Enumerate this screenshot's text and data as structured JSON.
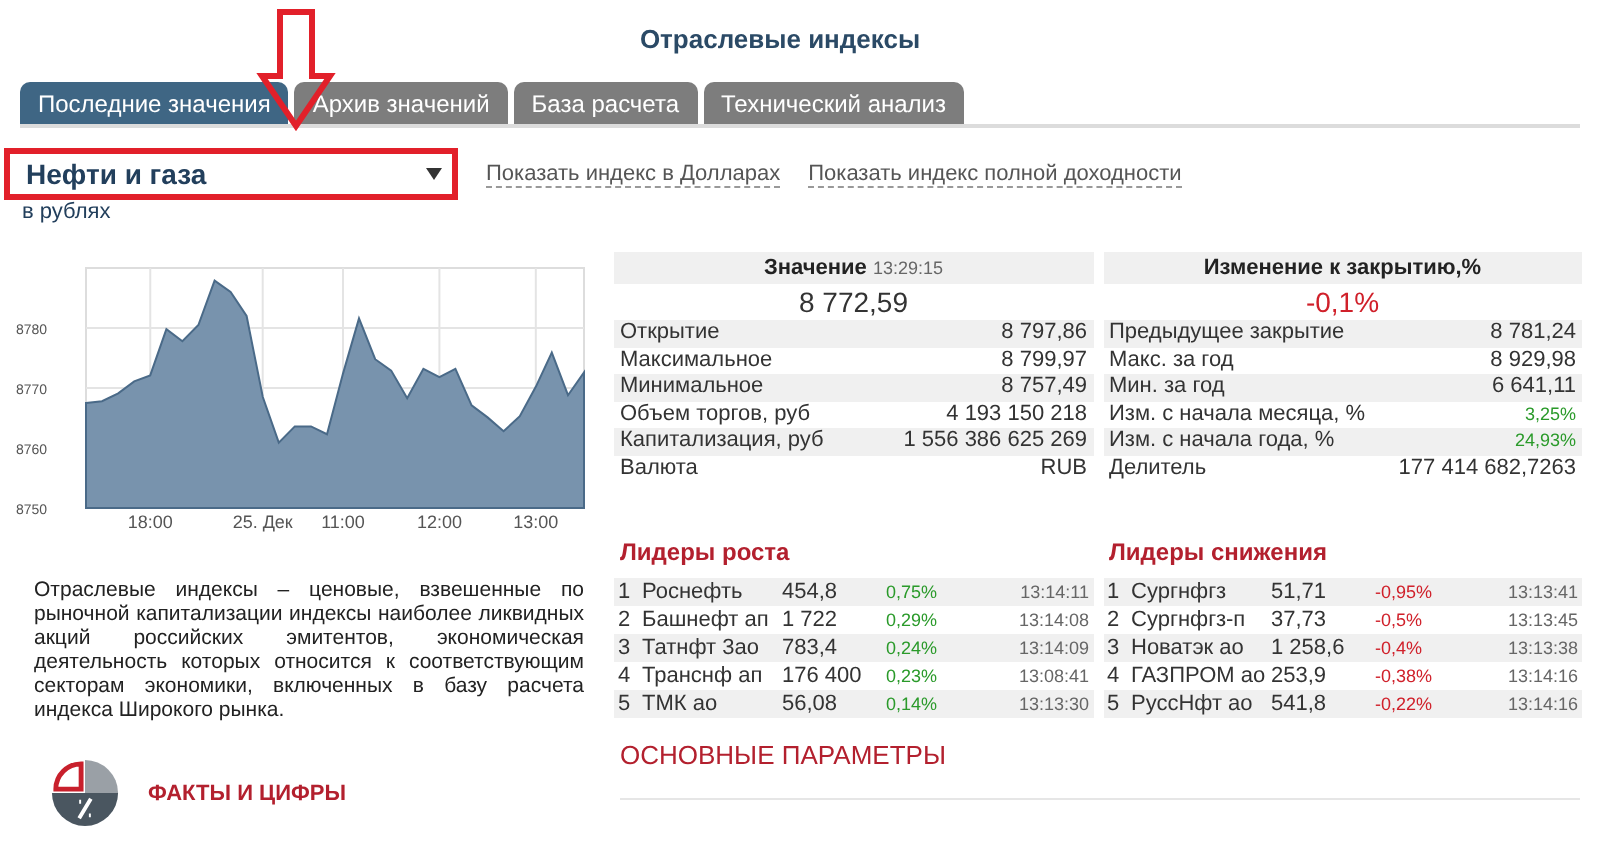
{
  "page_title": "Отраслевые индексы",
  "tabs": [
    {
      "label": "Последние значения",
      "selected": true
    },
    {
      "label": "Архив значений",
      "selected": false
    },
    {
      "label": "База расчета",
      "selected": false
    },
    {
      "label": "Технический анализ",
      "selected": false
    }
  ],
  "index_select": {
    "value": "Нефти и газа"
  },
  "links": [
    "Показать индекс в Долларах",
    "Показать индекс полной доходности"
  ],
  "currency_note": "в рублях",
  "chart": {
    "chart_data": {
      "type": "area",
      "categories": [
        null,
        null,
        null,
        null,
        "18:00",
        null,
        null,
        null,
        null,
        null,
        null,
        "25. Дек",
        null,
        null,
        null,
        null,
        "11:00",
        null,
        null,
        null,
        null,
        null,
        "12:00",
        null,
        null,
        null,
        null,
        null,
        "13:00",
        null,
        null,
        null
      ],
      "series": [
        {
          "color": "#7893ad",
          "values": [
            8767.5,
            8767.8,
            8769.1,
            8771.1,
            8772.1,
            8779.8,
            8777.8,
            8780.5,
            8787.9,
            8786,
            8782,
            8768.5,
            8760.9,
            8763.6,
            8763.6,
            8762.3,
            8772.4,
            8781.6,
            8774.8,
            8772.9,
            8768.3,
            8773.2,
            8771.8,
            8773.2,
            8767.1,
            8765.1,
            8762.8,
            8765.3,
            8770.2,
            8775.9,
            8768.8,
            8772.6
          ]
        }
      ],
      "ylim": [
        8750,
        8790
      ],
      "grid": true,
      "yticks": [
        8750,
        8760,
        8770,
        8780
      ]
    }
  },
  "description": "Отраслевые индексы – ценовые, взвешенные по рыночной капитализации индексы наиболее ликвидных акций российских эмитентов, экономическая деятельность которых относится к соответствующим секторам экономики, включенных в базу расчета индекса Широкого рынка.",
  "facts_link": "ФАКТЫ И ЦИФРЫ",
  "value_panel": {
    "heading": "Значение",
    "time": "13:29:15",
    "value": "8 772,59",
    "rows": [
      {
        "label": "Открытие",
        "value": "8 797,86"
      },
      {
        "label": "Максимальное",
        "value": "8 799,97"
      },
      {
        "label": "Минимальное",
        "value": "8 757,49"
      },
      {
        "label": "Объем торгов, руб",
        "value": "4 193 150 218"
      },
      {
        "label": "Капитализация, руб",
        "value": "1 556 386 625 269"
      },
      {
        "label": "Валюта",
        "value": "RUB"
      }
    ]
  },
  "change_panel": {
    "heading": "Изменение к закрытию,%",
    "value": "-0,1%",
    "negative": true,
    "rows": [
      {
        "label": "Предыдущее закрытие",
        "value": "8 781,24",
        "kind": "plain"
      },
      {
        "label": "Макс. за год",
        "value": "8 929,98",
        "kind": "plain"
      },
      {
        "label": "Мин. за год",
        "value": "6 641,11",
        "kind": "plain"
      },
      {
        "label": "Изм. с начала месяца, %",
        "value": "3,25%",
        "kind": "up"
      },
      {
        "label": "Изм. с начала года, %",
        "value": "24,93%",
        "kind": "up"
      },
      {
        "label": "Делитель",
        "value": "177 414 682,7263",
        "kind": "plain"
      }
    ]
  },
  "leaders": [
    {
      "title": "Лидеры роста",
      "kind": "up",
      "rows": [
        {
          "rank": "1",
          "name": "Роснефть",
          "price": "454,8",
          "change": "0,75%",
          "time": "13:14:11"
        },
        {
          "rank": "2",
          "name": "Башнефт ап",
          "price": "1 722",
          "change": "0,29%",
          "time": "13:14:08"
        },
        {
          "rank": "3",
          "name": "Татнфт 3ао",
          "price": "783,4",
          "change": "0,24%",
          "time": "13:14:09"
        },
        {
          "rank": "4",
          "name": "Транснф ап",
          "price": "176 400",
          "change": "0,23%",
          "time": "13:08:41"
        },
        {
          "rank": "5",
          "name": "ТМК ао",
          "price": "56,08",
          "change": "0,14%",
          "time": "13:13:30"
        }
      ]
    },
    {
      "title": "Лидеры снижения",
      "kind": "down",
      "rows": [
        {
          "rank": "1",
          "name": "Сургнфгз",
          "price": "51,71",
          "change": "-0,95%",
          "time": "13:13:41"
        },
        {
          "rank": "2",
          "name": "Сургнфгз-п",
          "price": "37,73",
          "change": "-0,5%",
          "time": "13:13:45"
        },
        {
          "rank": "3",
          "name": "Новатэк ао",
          "price": "1 258,6",
          "change": "-0,4%",
          "time": "13:13:38"
        },
        {
          "rank": "4",
          "name": "ГАЗПРОМ ао",
          "price": "253,9",
          "change": "-0,38%",
          "time": "13:14:16"
        },
        {
          "rank": "5",
          "name": "РуссНфт ао",
          "price": "541,8",
          "change": "-0,22%",
          "time": "13:14:16"
        }
      ]
    }
  ],
  "params_heading": "ОСНОВНЫЕ ПАРАМЕТРЫ"
}
